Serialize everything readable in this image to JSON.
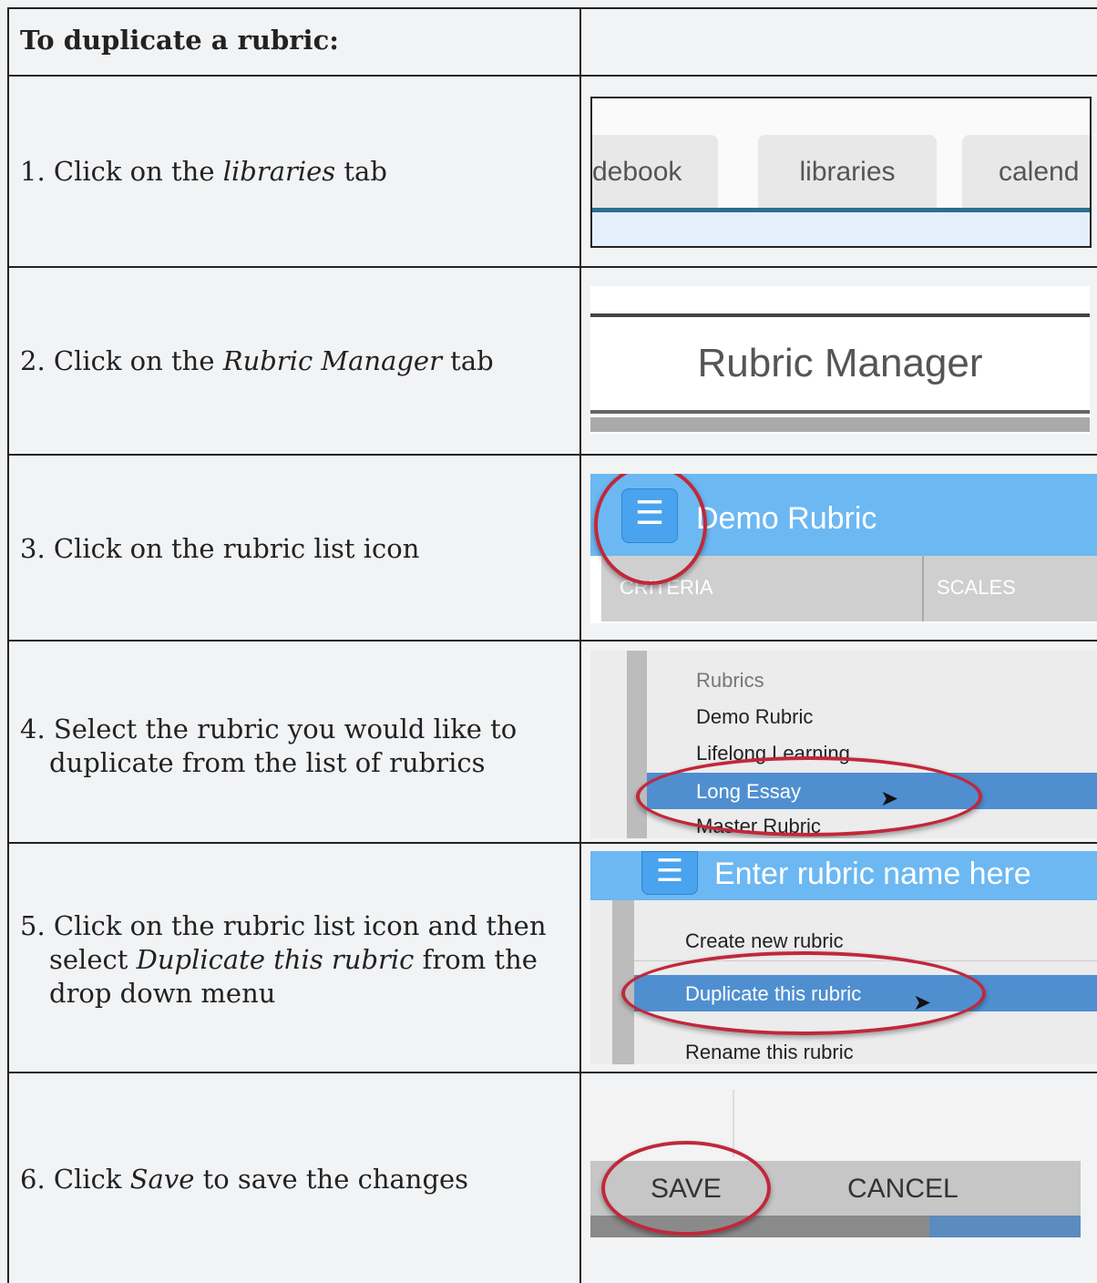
{
  "title": "To duplicate a rubric:",
  "steps": [
    {
      "num": "1.",
      "pre": "Click on the ",
      "em": "libraries",
      "post": " tab"
    },
    {
      "num": "2.",
      "pre": "Click on the ",
      "em": "Rubric Manager",
      "post": " tab"
    },
    {
      "num": "3.",
      "pre": "Click on the rubric list icon",
      "em": "",
      "post": ""
    },
    {
      "num": "4.",
      "line1": "Select the rubric you would like to",
      "line2": "duplicate from the list of rubrics"
    },
    {
      "num": "5.",
      "line1": "Click on the rubric list icon and then",
      "line2_pre": "select ",
      "line2_em": "Duplicate this rubric",
      "line2_post": " from the",
      "line3": "drop down menu"
    },
    {
      "num": "6.",
      "pre": "Click ",
      "em": "Save",
      "post": " to save the changes"
    }
  ],
  "shot1": {
    "tabs": [
      "debook",
      "libraries",
      "calend"
    ]
  },
  "shot2": {
    "label": "Rubric Manager"
  },
  "shot3": {
    "rubric_name": "Demo Rubric",
    "col1": "CRITERIA",
    "col2": "SCALES"
  },
  "shot4": {
    "header": "Rubrics",
    "items": [
      "Demo Rubric",
      "Lifelong Learning",
      "Long Essay",
      "Master Rubric"
    ]
  },
  "shot5": {
    "placeholder": "Enter rubric name here",
    "menu": [
      "Create new rubric",
      "Duplicate this rubric",
      "Rename this rubric"
    ]
  },
  "shot6": {
    "save": "SAVE",
    "cancel": "CANCEL"
  },
  "colors": {
    "accent_blue": "#4a90d9",
    "highlight_red": "#c0283a",
    "tab_line": "#2a6f8f"
  }
}
